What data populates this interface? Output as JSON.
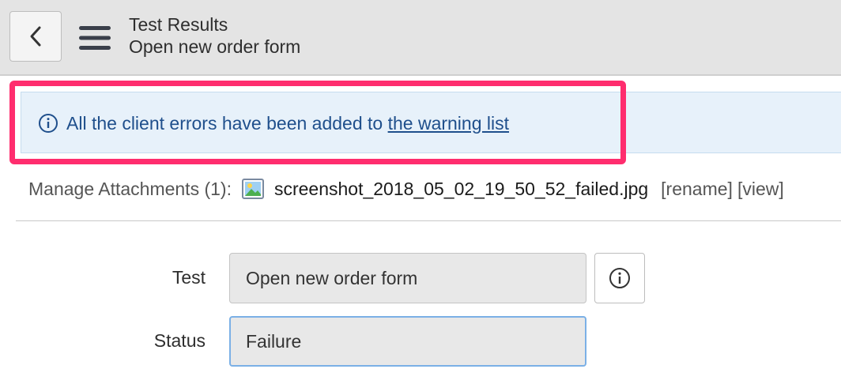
{
  "header": {
    "title": "Test Results",
    "subtitle": "Open new order form",
    "back_icon": "chevron-left-icon",
    "menu_icon": "hamburger-menu-icon"
  },
  "info_message": {
    "text": "All the client errors have been added to ",
    "link_text": "the warning list",
    "icon": "info-circle-icon",
    "color": "#1f4f8c",
    "background": "#e7f1fa",
    "highlight_color": "#ff2d6e"
  },
  "attachments": {
    "label": "Manage Attachments (1):",
    "file_icon": "image-file-icon",
    "file_name": "screenshot_2018_05_02_19_50_52_failed.jpg",
    "rename_label": "[rename]",
    "view_label": "[view]"
  },
  "form": {
    "test_label": "Test",
    "test_value": "Open new order form",
    "status_label": "Status",
    "status_value": "Failure",
    "info_icon": "info-circle-icon"
  }
}
